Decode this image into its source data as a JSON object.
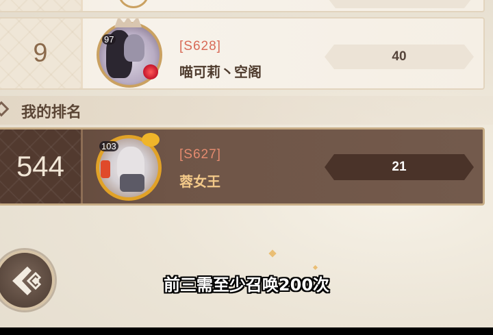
{
  "ranking_list": {
    "rows": [
      {
        "rank": "9",
        "level": "97",
        "server": "[S628]",
        "name": "喵可莉丶空阁",
        "score": "40"
      }
    ]
  },
  "my_ranking": {
    "title": "我的排名",
    "rank": "544",
    "level": "103",
    "server": "[S627]",
    "name": "蓉女王",
    "score": "21"
  },
  "subtitle": "前三需至少召唤200次",
  "icons": {
    "section": "diamond-icon",
    "back": "back-arrow-icon"
  },
  "colors": {
    "highlight_row": "#6f5547",
    "server_tag": "#d86a57",
    "my_name": "#f3c989"
  }
}
